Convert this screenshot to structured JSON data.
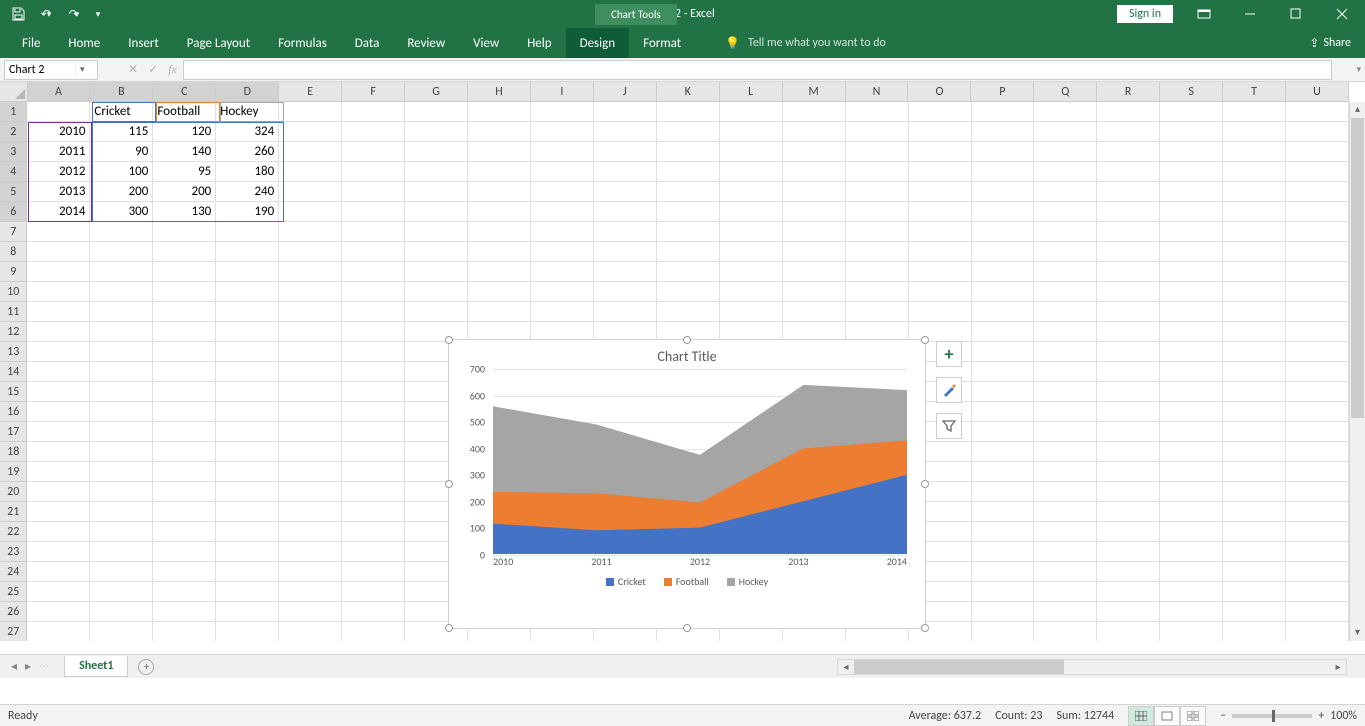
{
  "app": {
    "title": "Book2 - Excel",
    "tool_context": "Chart Tools",
    "signin": "Sign in"
  },
  "ribbon": {
    "tabs": [
      "File",
      "Home",
      "Insert",
      "Page Layout",
      "Formulas",
      "Data",
      "Review",
      "View",
      "Help",
      "Design",
      "Format"
    ],
    "active": "Design",
    "tell_me": "Tell me what you want to do",
    "share": "Share"
  },
  "namebox": {
    "value": "Chart 2"
  },
  "grid": {
    "columns": [
      "A",
      "B",
      "C",
      "D",
      "E",
      "F",
      "G",
      "H",
      "I",
      "J",
      "K",
      "L",
      "M",
      "N",
      "O",
      "P",
      "Q",
      "R",
      "S",
      "T",
      "U"
    ],
    "headers": {
      "b": "Cricket",
      "c": "Football",
      "d": "Hockey"
    },
    "rows": [
      {
        "a": "2010",
        "b": "115",
        "c": "120",
        "d": "324"
      },
      {
        "a": "2011",
        "b": "90",
        "c": "140",
        "d": "260"
      },
      {
        "a": "2012",
        "b": "100",
        "c": "95",
        "d": "180"
      },
      {
        "a": "2013",
        "b": "200",
        "c": "200",
        "d": "240"
      },
      {
        "a": "2014",
        "b": "300",
        "c": "130",
        "d": "190"
      }
    ],
    "total_rows": 27
  },
  "chart_data": {
    "type": "area",
    "title": "Chart Title",
    "categories": [
      "2010",
      "2011",
      "2012",
      "2013",
      "2014"
    ],
    "series": [
      {
        "name": "Cricket",
        "values": [
          115,
          90,
          100,
          200,
          300
        ],
        "color": "#4472c4"
      },
      {
        "name": "Football",
        "values": [
          120,
          140,
          95,
          200,
          130
        ],
        "color": "#ed7d31"
      },
      {
        "name": "Hockey",
        "values": [
          324,
          260,
          180,
          240,
          190
        ],
        "color": "#a5a5a5"
      }
    ],
    "stacked": true,
    "ylim": [
      0,
      700
    ],
    "yticks": [
      0,
      100,
      200,
      300,
      400,
      500,
      600,
      700
    ]
  },
  "sheet": {
    "active": "Sheet1"
  },
  "status": {
    "ready": "Ready",
    "avg_label": "Average:",
    "avg": "637.2",
    "count_label": "Count:",
    "count": "23",
    "sum_label": "Sum:",
    "sum": "12744",
    "zoom": "100%"
  }
}
